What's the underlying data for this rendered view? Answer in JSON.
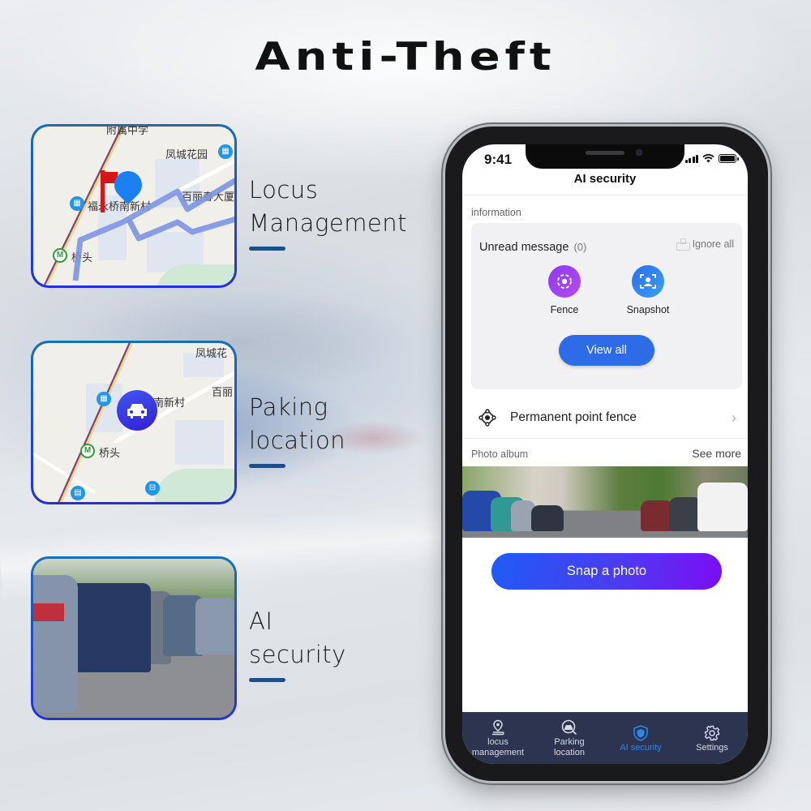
{
  "banner": {
    "title": "Anti-Theft"
  },
  "features": [
    {
      "line1": "Locus",
      "line2": "Management",
      "thumb": "map-with-track"
    },
    {
      "line1": "Paking",
      "line2": "location",
      "thumb": "map-with-car-marker"
    },
    {
      "line1": "AI",
      "line2": "security",
      "thumb": "parked-cars-photo"
    }
  ],
  "map_labels": {
    "top_cut": "附属中学",
    "fengcheng": "凤城花园",
    "bailichun": "百丽春大厦",
    "bailichun_short": "百丽",
    "fucheng_village": "福永桥南新村",
    "village_short": "南新村",
    "qiaotou": "桥头",
    "fengcheng_short": "凤城花",
    "metro_glyph": "M"
  },
  "phone": {
    "status": {
      "time": "9:41"
    },
    "header": {
      "title": "AI security"
    },
    "information": {
      "section_label": "information",
      "unread_label": "Unread message",
      "unread_count": "(0)",
      "ignore_all": "Ignore all",
      "quick_actions": [
        {
          "label": "Fence",
          "icon": "fence-target-icon",
          "color": "#9a3ff2"
        },
        {
          "label": "Snapshot",
          "icon": "snapshot-person-icon",
          "color": "#2f7cf2"
        }
      ],
      "view_all": "View all"
    },
    "permanent_fence": {
      "label": "Permanent point fence"
    },
    "album": {
      "section_label": "Photo album",
      "see_more": "See more"
    },
    "snap_button": "Snap a photo",
    "tabs": [
      {
        "label": "locus\nmanagement",
        "line1": "locus",
        "line2": "management",
        "icon": "location-pin-icon",
        "active": false
      },
      {
        "label": "Parking\nlocation",
        "line1": "Parking",
        "line2": "location",
        "icon": "parking-search-icon",
        "active": false
      },
      {
        "label": "AI security",
        "line1": "AI security",
        "line2": "",
        "icon": "shield-icon",
        "active": true
      },
      {
        "label": "Settings",
        "line1": "Settings",
        "line2": "",
        "icon": "gear-icon",
        "active": false
      }
    ],
    "accent_color": "#2d86ea",
    "tabbar_color": "#2d3450"
  }
}
